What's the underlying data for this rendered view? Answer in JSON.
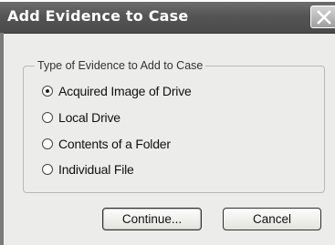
{
  "window": {
    "title": "Add Evidence to Case"
  },
  "group": {
    "legend": "Type of Evidence to Add to Case",
    "options": [
      {
        "label": "Acquired Image of Drive",
        "checked": true
      },
      {
        "label": "Local Drive",
        "checked": false
      },
      {
        "label": "Contents of a Folder",
        "checked": false
      },
      {
        "label": "Individual File",
        "checked": false
      }
    ]
  },
  "buttons": {
    "continue_label": "Continue...",
    "cancel_label": "Cancel"
  },
  "icons": {
    "close": "close-icon"
  },
  "colors": {
    "titlebar": "#555555",
    "dialog_background": "#ececea"
  }
}
